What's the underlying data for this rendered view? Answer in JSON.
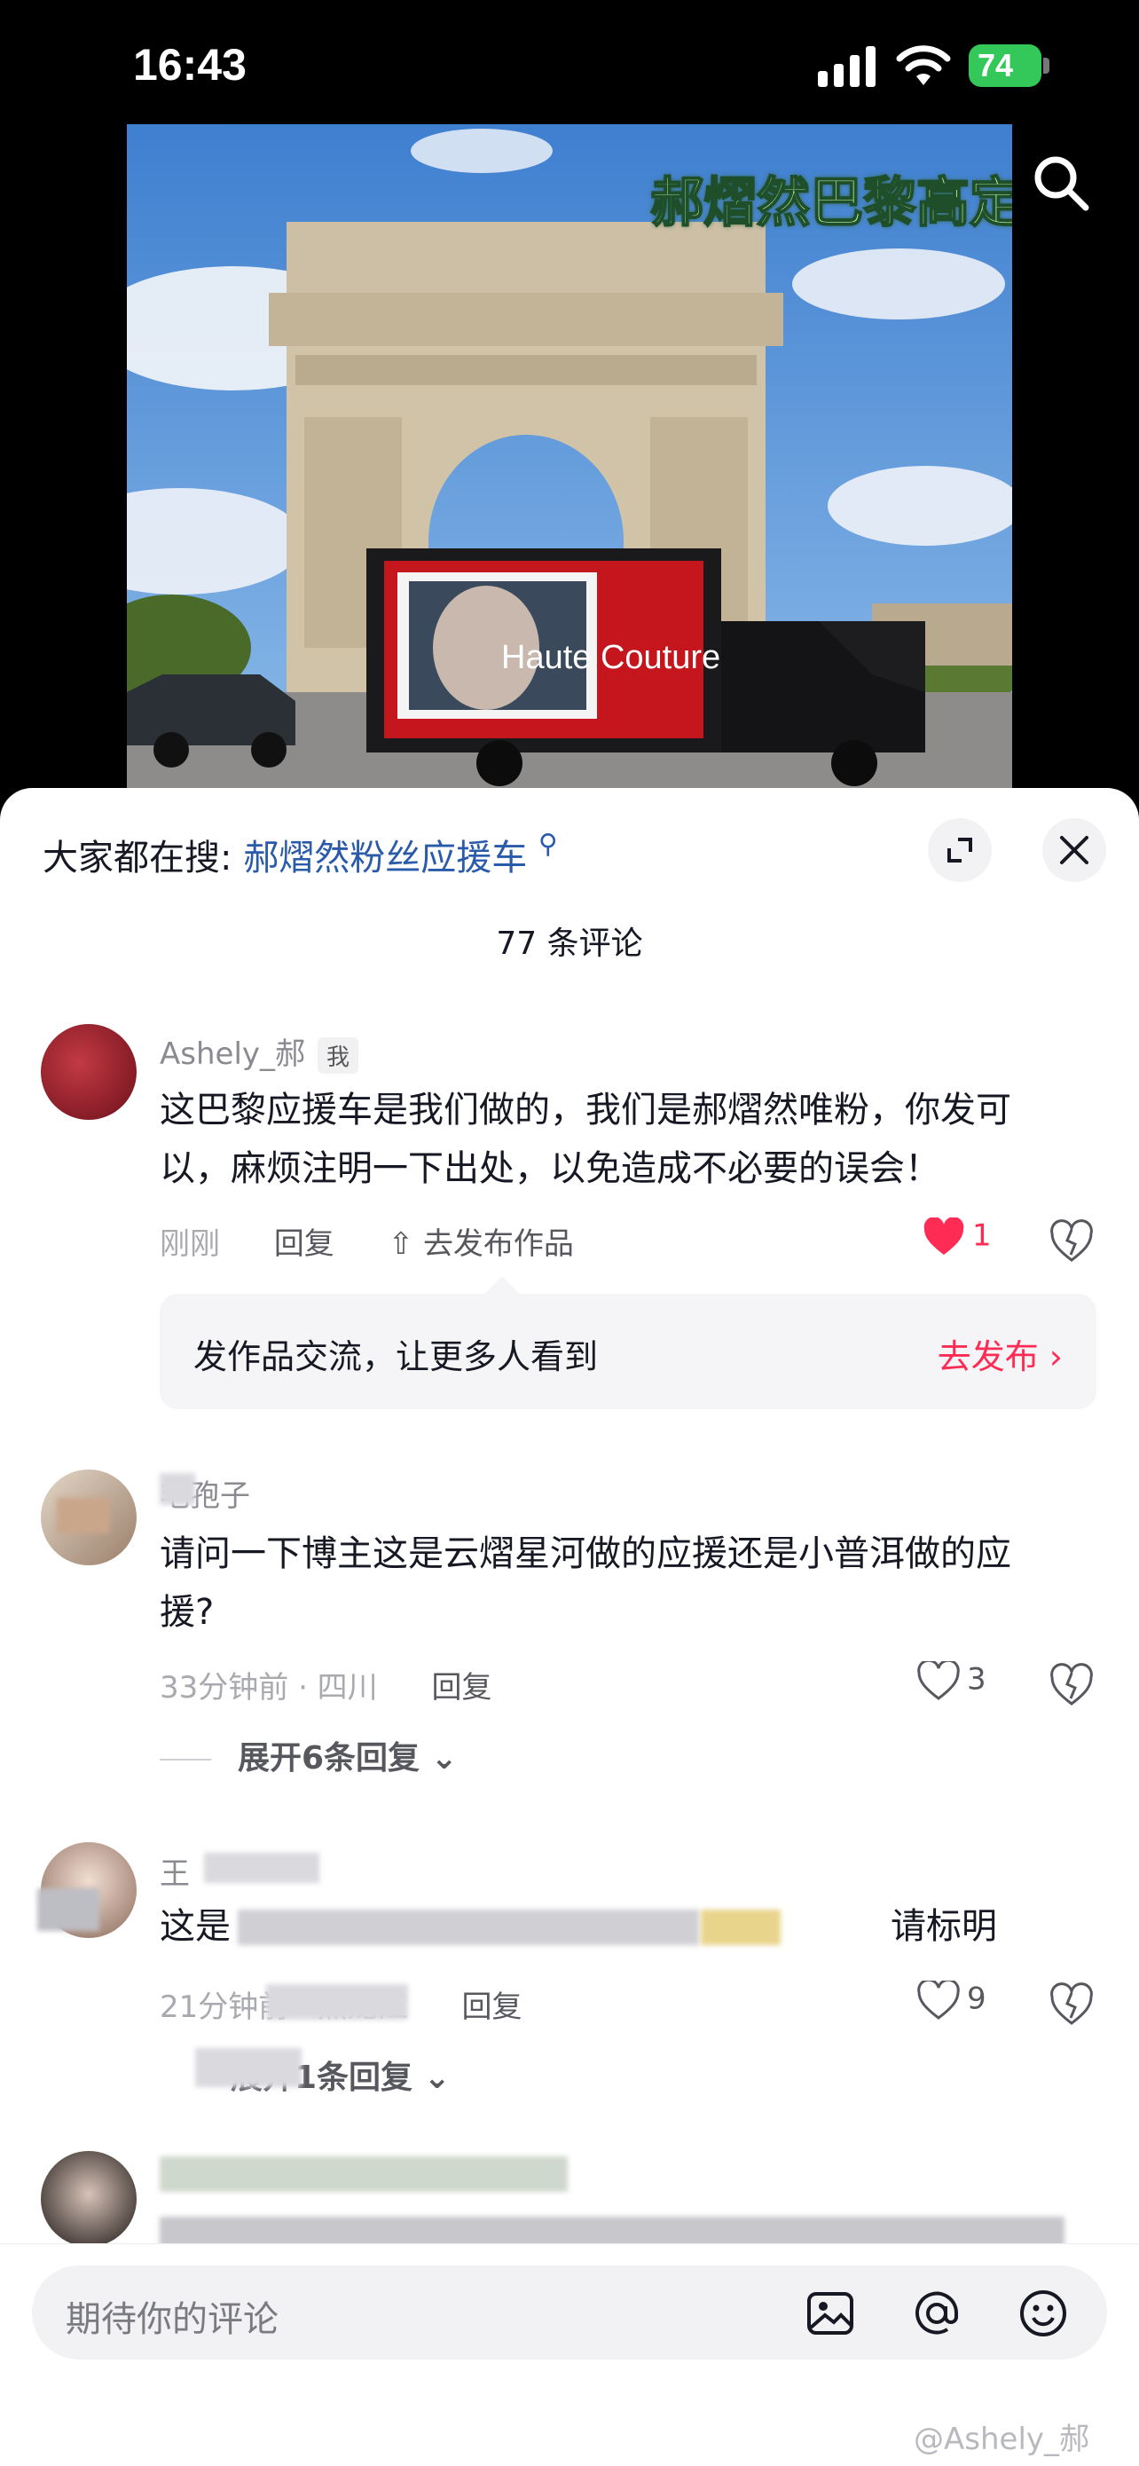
{
  "status_bar": {
    "time": "16:43",
    "battery": "74"
  },
  "video": {
    "title": "郝熠然巴黎高定",
    "truck_text": "Haute Couture",
    "icon": "search-icon"
  },
  "sheet": {
    "hot_search_prefix": "大家都在搜:",
    "hot_search_term": "郝熠然粉丝应援车",
    "comment_count": "77 条评论"
  },
  "comments": [
    {
      "username": "Ashely_郝",
      "badge": "我",
      "text": "这巴黎应援车是我们做的，我们是郝熠然唯粉，你发可以，麻烦注明一下出处，以免造成不必要的误会！",
      "time": "刚刚",
      "reply": "回复",
      "publish": "去发布作品",
      "likes": "1"
    },
    {
      "username": "毛孢子",
      "text": "请问一下博主这是云熠星河做的应援还是小普洱做的应援?",
      "time": "33分钟前 · 四川",
      "reply": "回复",
      "likes": "3",
      "expand": "展开6条回复"
    },
    {
      "username": "王",
      "text": "这是",
      "text_end": "请标明",
      "time": "21分钟前 · 黑龙江",
      "reply": "回复",
      "likes": "9",
      "expand": "展开1条回复"
    }
  ],
  "publish_card": {
    "text": "发作品交流，让更多人看到",
    "action": "去发布 ›"
  },
  "input": {
    "placeholder": "期待你的评论",
    "icons": [
      "image-icon",
      "at-icon",
      "emoji-icon"
    ]
  },
  "watermark": "@Ashely_郝",
  "colors": {
    "accent": "#fe2c55",
    "link": "#2a5baa",
    "battery": "#34c759"
  }
}
